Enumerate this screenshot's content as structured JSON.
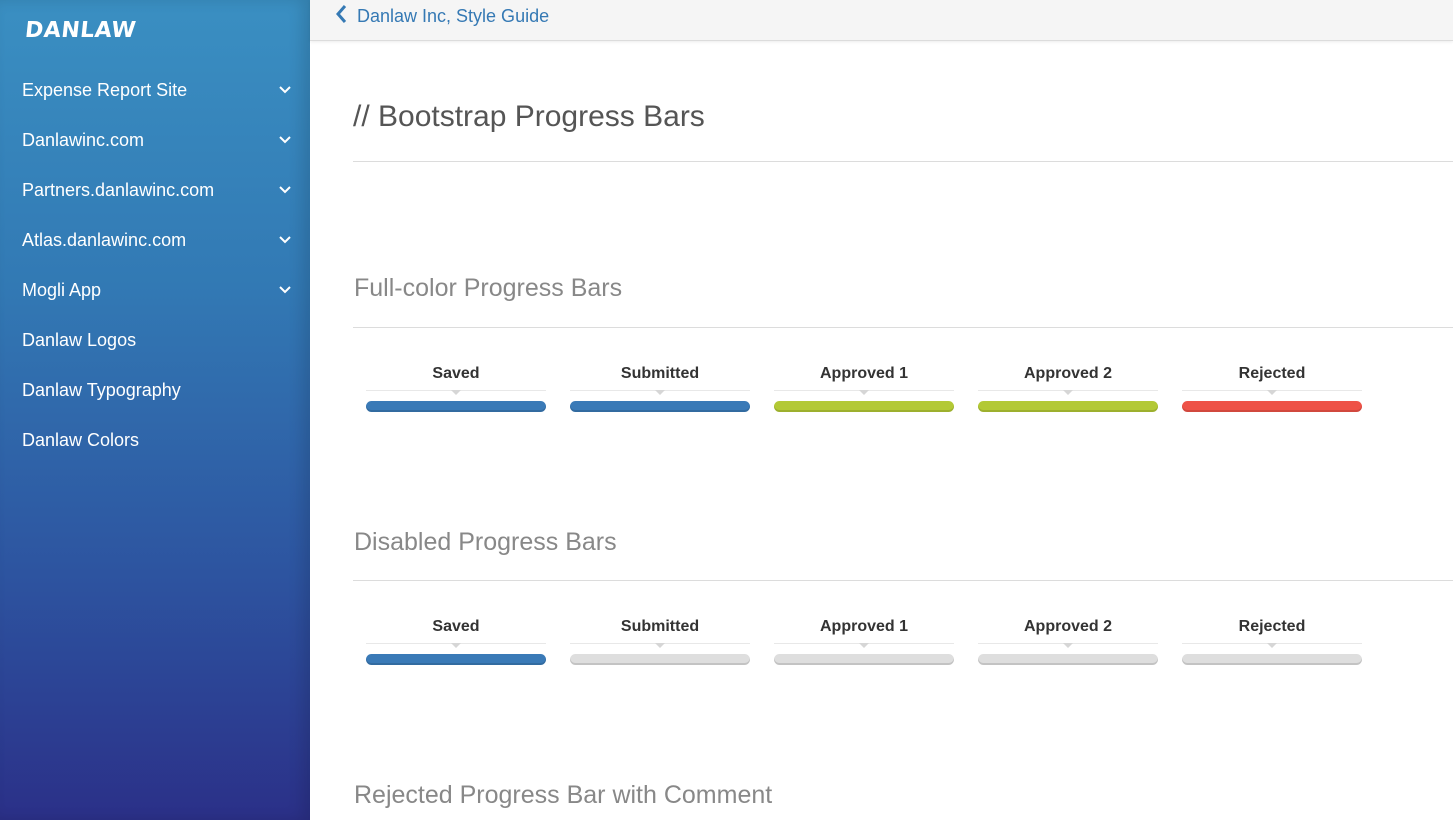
{
  "sidebar": {
    "logo": "DANLAW",
    "items": [
      {
        "label": "Expense Report Site",
        "expandable": true
      },
      {
        "label": "Danlawinc.com",
        "expandable": true
      },
      {
        "label": "Partners.danlawinc.com",
        "expandable": true
      },
      {
        "label": "Atlas.danlawinc.com",
        "expandable": true
      },
      {
        "label": "Mogli App",
        "expandable": true
      },
      {
        "label": "Danlaw Logos",
        "expandable": false
      },
      {
        "label": "Danlaw Typography",
        "expandable": false
      },
      {
        "label": "Danlaw Colors",
        "expandable": false
      }
    ]
  },
  "topbar": {
    "back_label": "Danlaw Inc, Style Guide",
    "back_icon": "chevron-left-icon"
  },
  "main": {
    "title": "// Bootstrap Progress Bars",
    "sections": [
      {
        "title": "Full-color Progress Bars",
        "steps": [
          {
            "label": "Saved",
            "color": "#3a7ab7"
          },
          {
            "label": "Submitted",
            "color": "#3a7ab7"
          },
          {
            "label": "Approved 1",
            "color": "#b3c935"
          },
          {
            "label": "Approved 2",
            "color": "#b3c935"
          },
          {
            "label": "Rejected",
            "color": "#ee5247"
          }
        ]
      },
      {
        "title": "Disabled Progress Bars",
        "steps": [
          {
            "label": "Saved",
            "color": "#3a7ab7"
          },
          {
            "label": "Submitted",
            "color": "#dedede"
          },
          {
            "label": "Approved 1",
            "color": "#dedede"
          },
          {
            "label": "Approved 2",
            "color": "#dedede"
          },
          {
            "label": "Rejected",
            "color": "#dedede"
          }
        ]
      },
      {
        "title": "Rejected Progress Bar with Comment",
        "steps": []
      }
    ]
  },
  "colors": {
    "accent": "#3579b4",
    "sidebar_top": "#3a8fc2",
    "sidebar_bottom": "#2b3088"
  }
}
